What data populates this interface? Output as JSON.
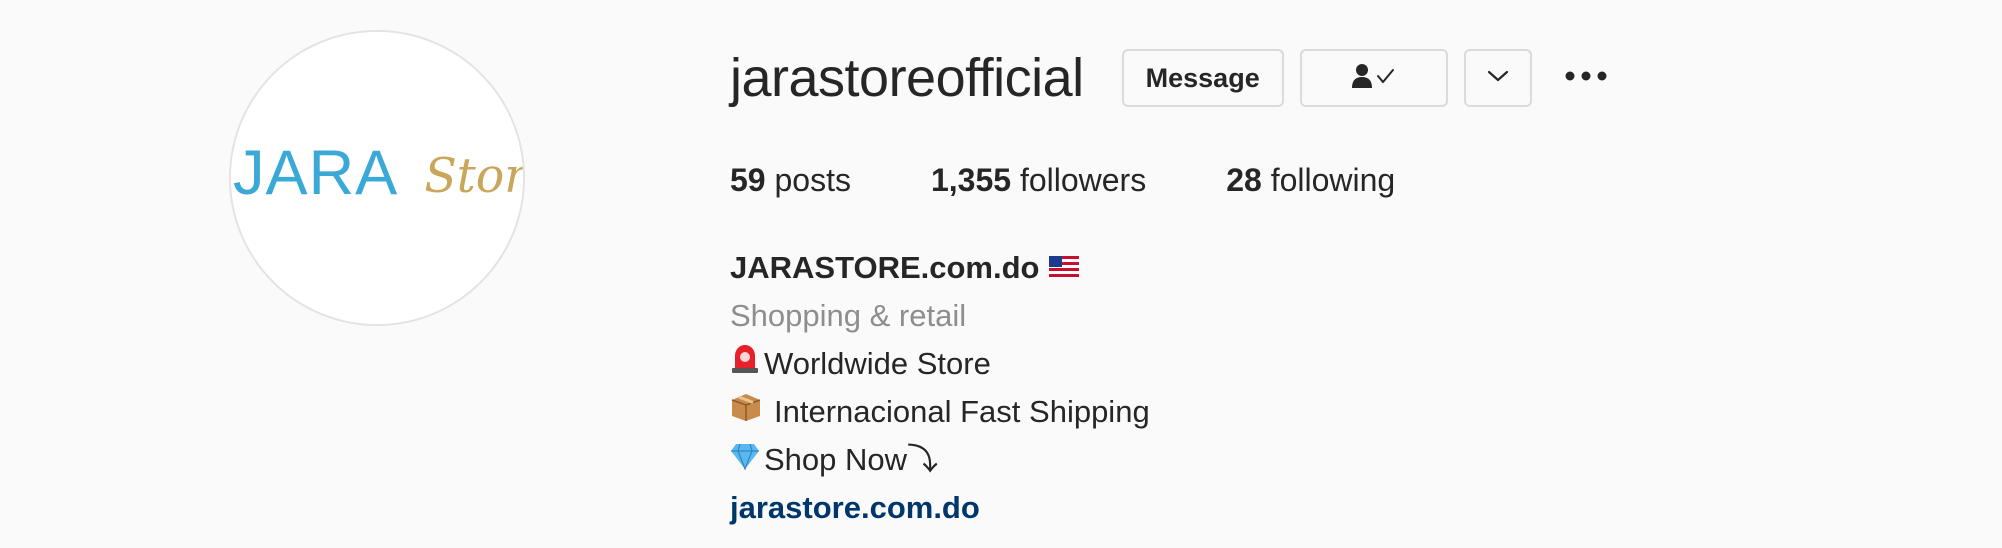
{
  "profile": {
    "username": "jarastoreofficial",
    "avatar_logo": {
      "primary": "JARA",
      "secondary": "Store"
    },
    "buttons": {
      "message": "Message",
      "following_icon": "person-check-icon",
      "suggest_icon": "chevron-down-icon",
      "more_icon": "more-horizontal-icon"
    },
    "stats": {
      "posts_count": "59",
      "posts_label": "posts",
      "followers_count": "1,355",
      "followers_label": "followers",
      "following_count": "28",
      "following_label": "following"
    },
    "bio": {
      "name": "JARASTORE.com.do",
      "name_icon": "us-flag-icon",
      "category": "Shopping & retail",
      "lines": [
        {
          "icon": "siren-icon",
          "text": "Worldwide Store"
        },
        {
          "icon": "package-icon",
          "text": "Internacional Fast Shipping"
        },
        {
          "icon": "gem-icon",
          "text": "Shop Now⤵"
        }
      ],
      "website": "jarastore.com.do"
    }
  },
  "colors": {
    "background": "#fafafa",
    "text": "#262626",
    "secondary_text": "#8e8e8e",
    "link": "#00376b",
    "border": "#dbdbdb",
    "logo_blue": "#3aa9d6",
    "logo_gold": "#c9a65a"
  }
}
